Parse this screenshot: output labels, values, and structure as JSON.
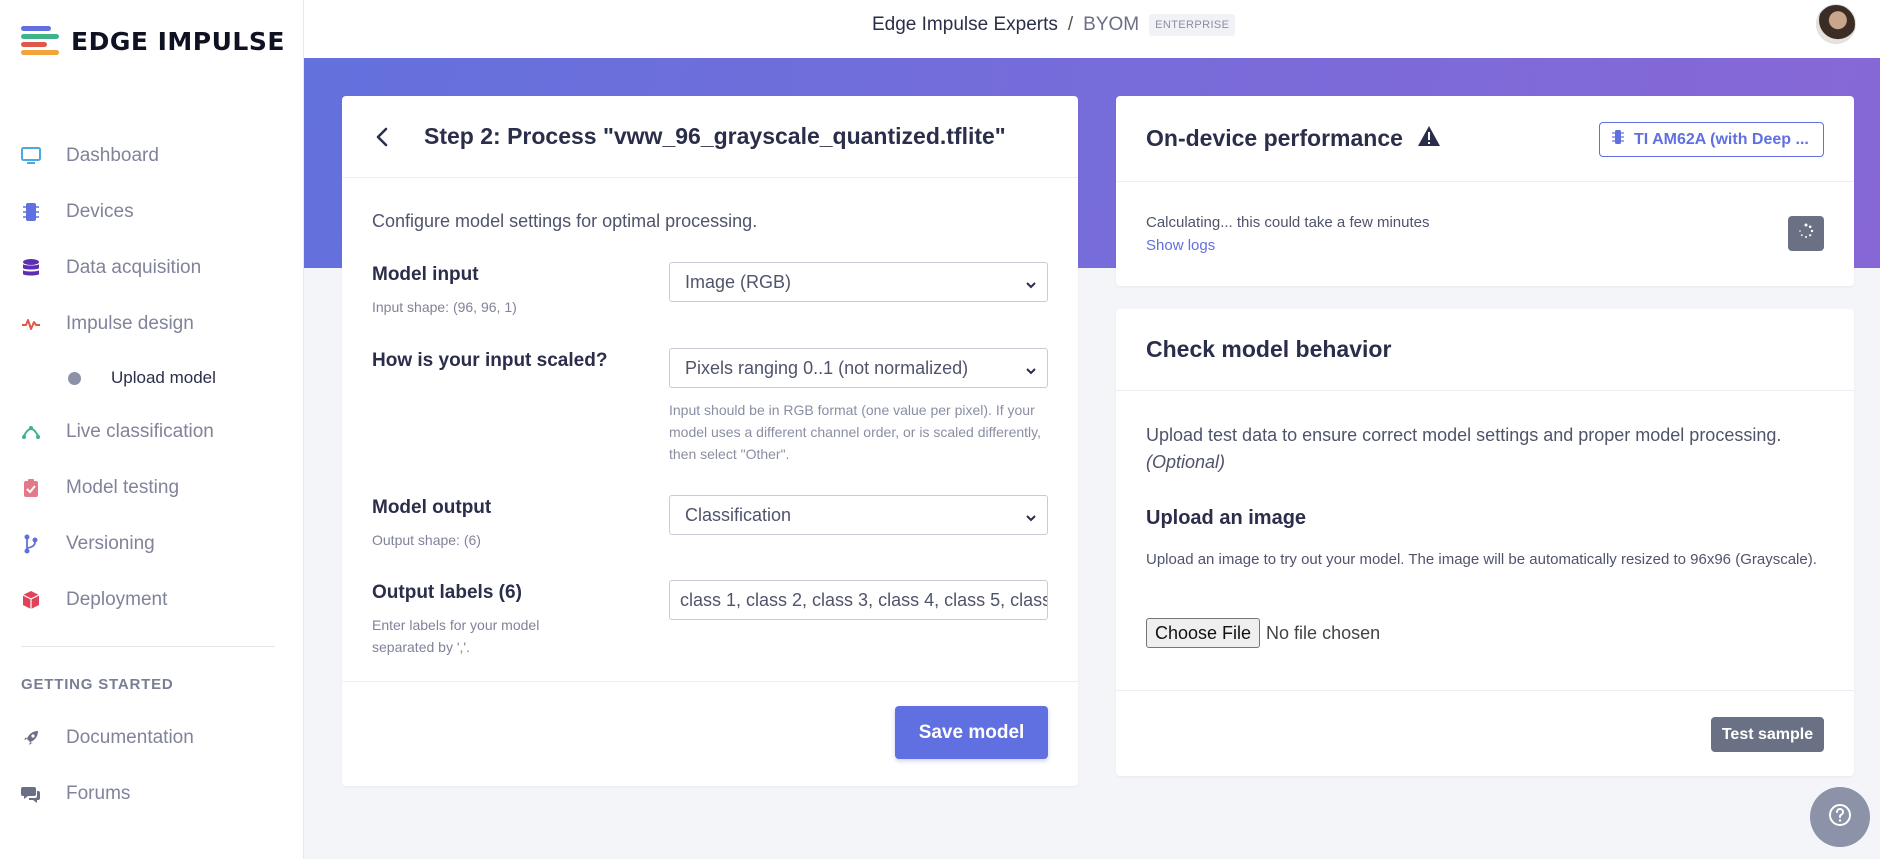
{
  "app": {
    "logo_text": "EDGE IMPULSE"
  },
  "sidebar": {
    "items": [
      {
        "label": "Dashboard",
        "icon": "monitor-icon",
        "color": "#4aa9e0"
      },
      {
        "label": "Devices",
        "icon": "chip-icon",
        "color": "#6070e0"
      },
      {
        "label": "Data acquisition",
        "icon": "database-icon",
        "color": "#5b2fb0"
      },
      {
        "label": "Impulse design",
        "icon": "pulse-icon",
        "color": "#e0584a"
      }
    ],
    "sub_items": [
      {
        "label": "Upload model"
      }
    ],
    "items2": [
      {
        "label": "Live classification",
        "icon": "live-icon",
        "color": "#3fb38a"
      },
      {
        "label": "Model testing",
        "icon": "clipboard-check-icon",
        "color": "#e27a8a"
      },
      {
        "label": "Versioning",
        "icon": "branch-icon",
        "color": "#6070e0"
      },
      {
        "label": "Deployment",
        "icon": "box-icon",
        "color": "#e0425a"
      }
    ],
    "section_label": "GETTING STARTED",
    "getting_started": [
      {
        "label": "Documentation",
        "icon": "rocket-icon"
      },
      {
        "label": "Forums",
        "icon": "chat-icon"
      }
    ]
  },
  "topbar": {
    "project": "Edge Impulse Experts",
    "separator": "/",
    "page": "BYOM",
    "badge": "ENTERPRISE"
  },
  "step": {
    "title": "Step 2: Process \"vww_96_grayscale_quantized.tflite\"",
    "intro": "Configure model settings for optimal processing.",
    "model_input": {
      "label": "Model input",
      "help": "Input shape: (96, 96, 1)",
      "value": "Image (RGB)"
    },
    "input_scaling": {
      "label": "How is your input scaled?",
      "value": "Pixels ranging 0..1 (not normalized)",
      "note": "Input should be in RGB format (one value per pixel). If your model uses a different channel order, or is scaled differently, then select \"Other\"."
    },
    "model_output": {
      "label": "Model output",
      "help": "Output shape: (6)",
      "value": "Classification"
    },
    "output_labels": {
      "label": "Output labels (6)",
      "help": "Enter labels for your model separated by ','.",
      "value": "class 1, class 2, class 3, class 4, class 5, class"
    },
    "save_label": "Save model"
  },
  "performance": {
    "title": "On-device performance",
    "device": "TI AM62A (with Deep ...",
    "calculating": "Calculating... this could take a few minutes",
    "show_logs": "Show logs"
  },
  "check": {
    "title": "Check model behavior",
    "desc": "Upload test data to ensure correct model settings and proper model processing.",
    "optional": "(Optional)",
    "upload_title": "Upload an image",
    "upload_desc": "Upload an image to try out your model. The image will be automatically resized to 96x96 (Grayscale).",
    "choose_file": "Choose File",
    "no_file": "No file chosen",
    "test_label": "Test sample"
  },
  "colors": {
    "accent": "#6070e0",
    "hero_start": "#6371dd",
    "hero_end": "#8767d6"
  }
}
